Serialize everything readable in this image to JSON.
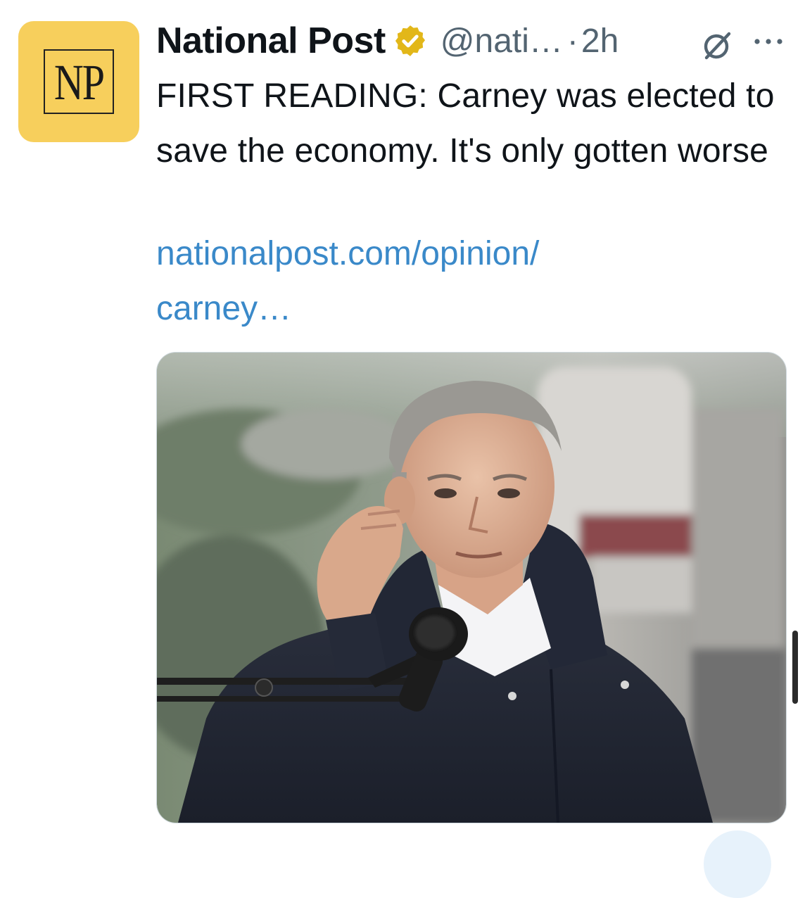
{
  "tweet": {
    "avatar": {
      "logo_text": "NP",
      "background_color": "#f7cf5c"
    },
    "author": {
      "display_name": "National Post",
      "verified": true,
      "verified_badge_color": "#e2b719",
      "handle": "@nati…",
      "separator": "·",
      "time": "2h"
    },
    "icons": {
      "grok": "grok-icon",
      "more": "more-options-icon"
    },
    "text": "FIRST READING: Carney was elected to save the economy. It's only gotten worse",
    "link": {
      "line1": "nationalpost.com/opinion/",
      "line2": "carney…",
      "color": "#3a89c9"
    },
    "media": {
      "type": "photo"
    }
  }
}
